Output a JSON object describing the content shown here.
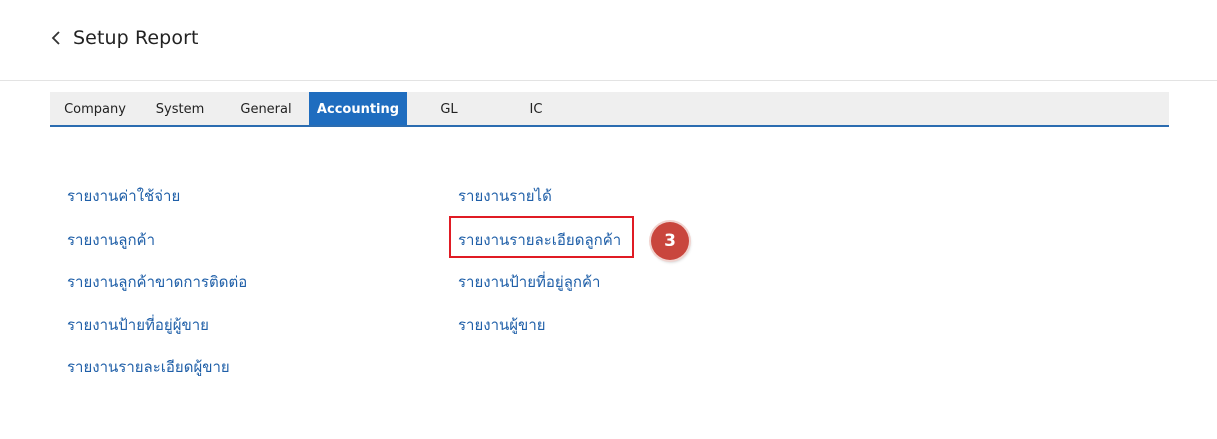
{
  "header": {
    "back_icon": "chevron-left-icon",
    "title": "Setup Report"
  },
  "tabs": [
    {
      "label": "Company",
      "active": false
    },
    {
      "label": "System",
      "active": false
    },
    {
      "label": "General",
      "active": false
    },
    {
      "label": "Accounting",
      "active": true
    },
    {
      "label": "GL",
      "active": false
    },
    {
      "label": "IC",
      "active": false
    }
  ],
  "reports": {
    "left": [
      "รายงานค่าใช้จ่าย",
      "รายงานลูกค้า",
      "รายงานลูกค้าขาดการติดต่อ",
      "รายงานป้ายที่อยู่ผู้ขาย",
      "รายงานรายละเอียดผู้ขาย"
    ],
    "right": [
      "รายงานรายได้",
      "รายงานรายละเอียดลูกค้า",
      "รายงานป้ายที่อยู่ลูกค้า",
      "รายงานผู้ขาย"
    ]
  },
  "annotation": {
    "step_number": "3",
    "highlight_color": "#e01b24",
    "badge_color": "#c9463d"
  },
  "colors": {
    "accent": "#1f6dbf",
    "link": "#1f5fa8"
  }
}
